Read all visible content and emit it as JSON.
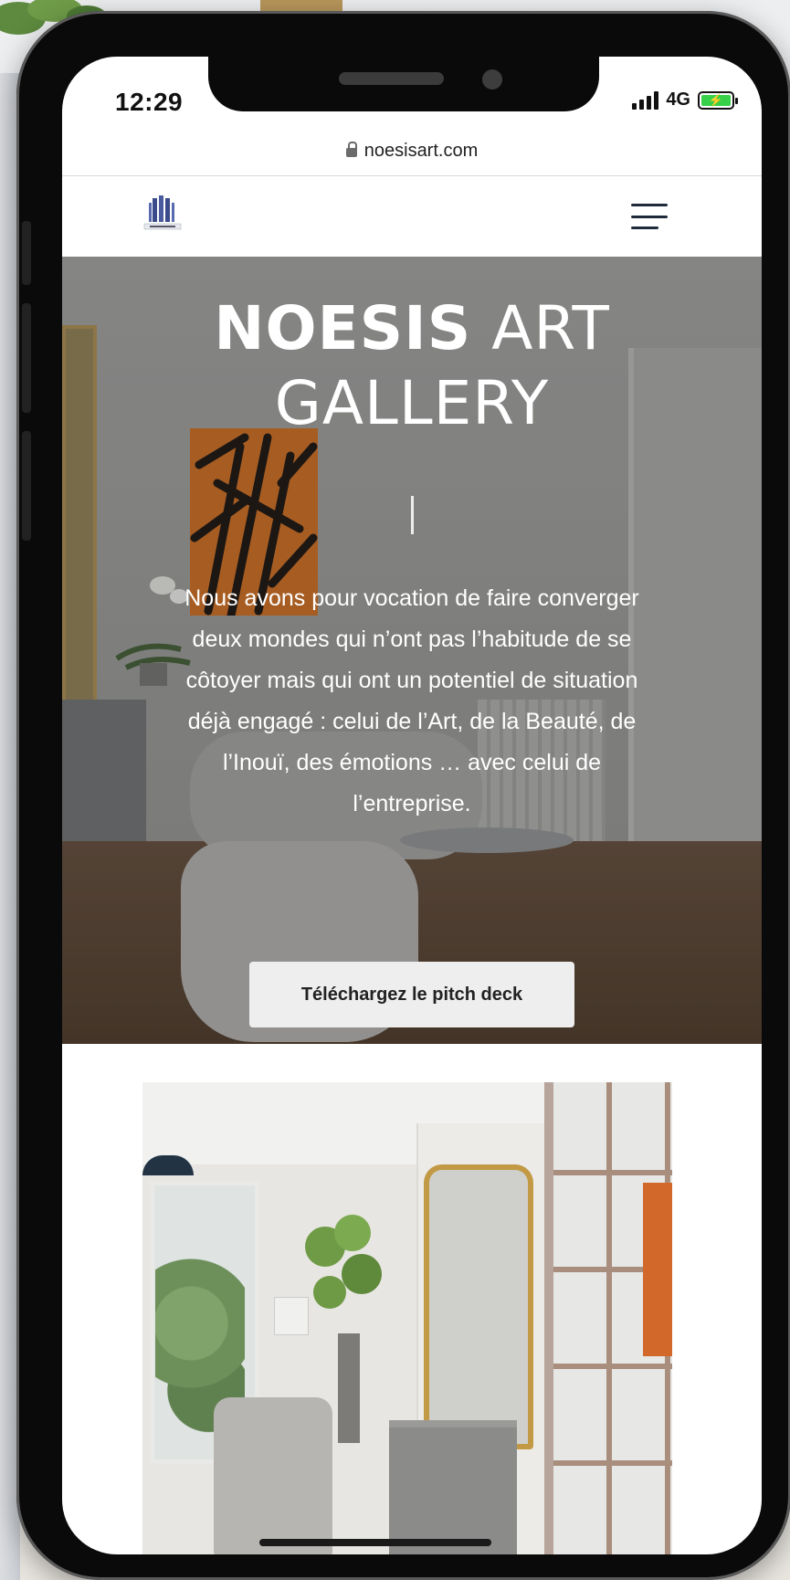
{
  "status_bar": {
    "time": "12:29",
    "network": "4G",
    "battery_icon": "battery-charging-icon",
    "signal_icon": "signal-bars-icon"
  },
  "browser": {
    "url": "noesisart.com",
    "lock_icon": "lock-icon"
  },
  "nav": {
    "logo_icon": "noesis-logo",
    "menu_icon": "hamburger-menu-icon"
  },
  "hero": {
    "title_bold": "NOESIS",
    "title_light": " ART",
    "title_line2": "GALLERY",
    "text": "Nous avons pour vocation de faire converger deux mondes qui n’ont pas l’habitude de se côtoyer mais qui ont un potentiel de situation déjà engagé : celui de l’Art, de la Beauté, de l’Inouï, des émotions … avec celui de l’entreprise.",
    "cta_label": "Téléchargez le pitch deck"
  },
  "colors": {
    "nav_icon": "#1e2a3a",
    "logo": "#3a4a8a",
    "cta_bg": "#eeeeee",
    "battery": "#37d049"
  }
}
